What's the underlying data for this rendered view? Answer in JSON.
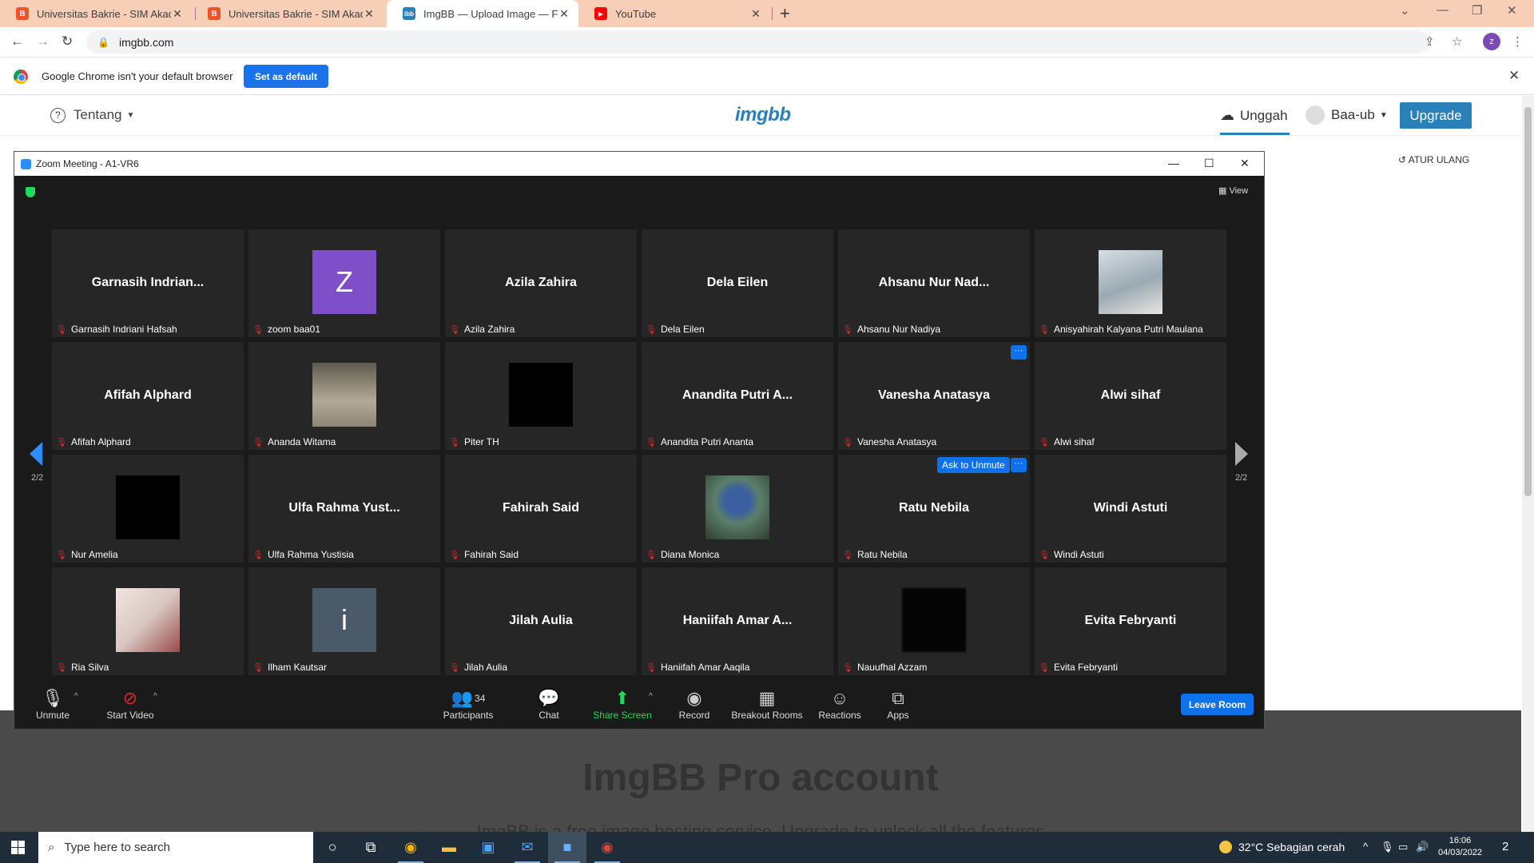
{
  "browser": {
    "tabs": [
      {
        "title": "Universitas Bakrie - SIM Akadem",
        "favicon_color": "#e8562a",
        "favicon": "B"
      },
      {
        "title": "Universitas Bakrie - SIM Akadem",
        "favicon_color": "#e8562a",
        "favicon": "B"
      },
      {
        "title": "ImgBB — Upload Image — Free",
        "favicon_color": "#2a80b9",
        "favicon": "ibb"
      },
      {
        "title": "YouTube",
        "favicon_color": "#ff0000",
        "favicon": "▶"
      }
    ],
    "url": "imgbb.com",
    "profile_initial": "z",
    "infobar": {
      "message": "Google Chrome isn't your default browser",
      "button": "Set as default"
    }
  },
  "imgbb": {
    "nav_about": "Tentang",
    "logo": "imgbb",
    "upload": "Unggah",
    "user": "Baa-ub",
    "upgrade": "Upgrade",
    "reset": "ATUR ULANG",
    "pro_title": "ImgBB Pro account",
    "pro_sub": "ImgBB is a free image hosting service. Upgrade to unlock all the features"
  },
  "zoom": {
    "window_title": "Zoom Meeting - A1-VR6",
    "view": "View",
    "page_left": "2/2",
    "page_right": "2/2",
    "participants": [
      {
        "name": "Garnasih Indriani Hafsah",
        "display": "Garnasih Indrian..."
      },
      {
        "name": "zoom baa01",
        "avatar": "Z",
        "avatar_color": "#7f4fc9"
      },
      {
        "name": "Azila Zahira",
        "display": "Azila Zahira"
      },
      {
        "name": "Dela Eilen",
        "display": "Dela Eilen"
      },
      {
        "name": "Ahsanu Nur Nadiya",
        "display": "Ahsanu Nur Nad..."
      },
      {
        "name": "Anisyahirah Kalyana Putri Maulana",
        "photo": "#aab8c2"
      },
      {
        "name": "Afifah Alphard",
        "display": "Afifah Alphard"
      },
      {
        "name": "Ananda Witama",
        "photo": "#8b8574"
      },
      {
        "name": "Piter TH",
        "photo": "#000000"
      },
      {
        "name": "Anandita Putri Ananta",
        "display": "Anandita Putri A..."
      },
      {
        "name": "Vanesha Anatasya",
        "display": "Vanesha Anatasya"
      },
      {
        "name": "Alwi sihaf",
        "display": "Alwi sihaf"
      },
      {
        "name": "Nur Amelia",
        "photo": "#000000"
      },
      {
        "name": "Ulfa Rahma Yustisia",
        "display": "Ulfa Rahma Yust..."
      },
      {
        "name": "Fahirah Said",
        "display": "Fahirah Said"
      },
      {
        "name": "Diana Monica",
        "photo": "#5b7f6a"
      },
      {
        "name": "Ratu Nebila",
        "display": "Ratu Nebila"
      },
      {
        "name": "Windi Astuti",
        "display": "Windi Astuti"
      },
      {
        "name": "Ria Silva",
        "photo": "#d9c7c2"
      },
      {
        "name": "Ilham Kautsar",
        "avatar": "i",
        "avatar_color": "#4a5a68"
      },
      {
        "name": "Jilah Aulia",
        "display": "Jilah Aulia"
      },
      {
        "name": "Haniifah Amar Aaqila",
        "display": "Haniifah Amar A..."
      },
      {
        "name": "Nauufhal Azzam",
        "photo": "#050505"
      },
      {
        "name": "Evita Febryanti",
        "display": "Evita Febryanti"
      }
    ],
    "ask_to_unmute": "Ask to Unmute",
    "more": "···",
    "controls": {
      "unmute": "Unmute",
      "start_video": "Start Video",
      "participants": "Participants",
      "participant_count": "34",
      "chat": "Chat",
      "share_screen": "Share Screen",
      "record": "Record",
      "breakout": "Breakout Rooms",
      "reactions": "Reactions",
      "apps": "Apps",
      "leave": "Leave Room"
    }
  },
  "taskbar": {
    "search_placeholder": "Type here to search",
    "weather": "32°C  Sebagian cerah",
    "time": "16:06",
    "date": "04/03/2022",
    "notifications": "2"
  }
}
